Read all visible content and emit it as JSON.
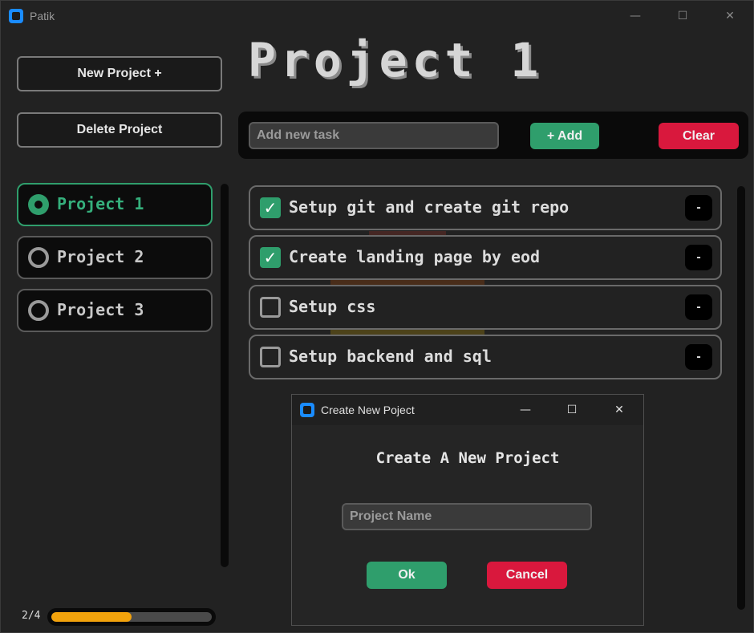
{
  "app": {
    "title": "Patik"
  },
  "sidebar": {
    "new_project_label": "New Project +",
    "delete_project_label": "Delete Project",
    "projects": [
      {
        "label": "Project 1",
        "selected": true
      },
      {
        "label": "Project 2",
        "selected": false
      },
      {
        "label": "Project 3",
        "selected": false
      }
    ],
    "progress": {
      "label": "2/4",
      "completed": 2,
      "total": 4,
      "fraction": 0.5,
      "color": "#f2a20c"
    }
  },
  "main": {
    "heading": "Project 1",
    "task_input_placeholder": "Add new task",
    "add_label": "+ Add",
    "clear_label": "Clear",
    "tasks": [
      {
        "label": "Setup git and create git repo",
        "done": true,
        "remove_label": "-"
      },
      {
        "label": "Create landing page by eod",
        "done": true,
        "remove_label": "-"
      },
      {
        "label": "Setup css",
        "done": false,
        "remove_label": "-"
      },
      {
        "label": "Setup backend and sql",
        "done": false,
        "remove_label": "-"
      }
    ]
  },
  "dialog": {
    "title": "Create New Poject",
    "heading": "Create A New Project",
    "input_placeholder": "Project Name",
    "ok_label": "Ok",
    "cancel_label": "Cancel"
  },
  "window_controls": {
    "minimize": "—",
    "maximize": "☐",
    "close": "✕"
  },
  "colors": {
    "accent": "#2f9e6c",
    "danger": "#d9183d",
    "progress": "#f2a20c",
    "app_icon": "#1a8cff"
  },
  "icons": {
    "check": "✓"
  }
}
